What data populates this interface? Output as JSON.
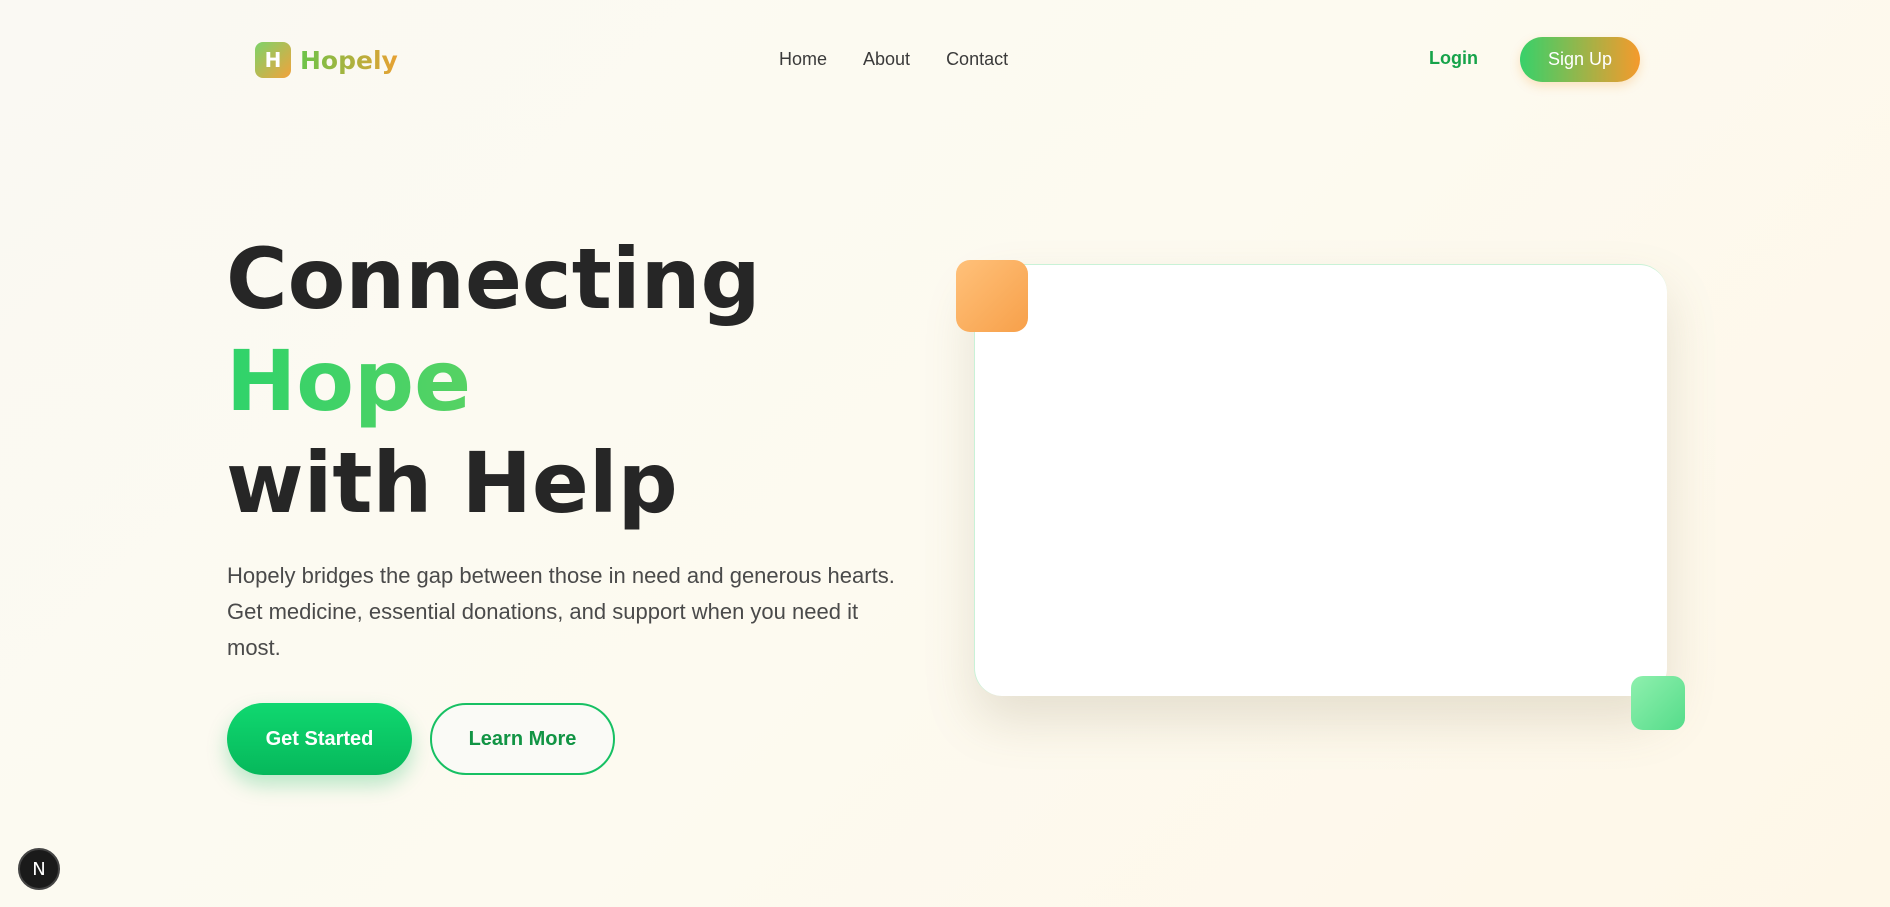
{
  "brand": {
    "logo_letter": "H",
    "name": "Hopely"
  },
  "nav": {
    "links": [
      "Home",
      "About",
      "Contact"
    ],
    "login_label": "Login",
    "signup_label": "Sign Up"
  },
  "hero": {
    "title_line1": "Connecting",
    "title_line2": "Hope",
    "title_line3": "with Help",
    "description": "Hopely bridges the gap between those in need and generous hearts. Get medicine, essential donations, and support when you need it most.",
    "primary_cta": "Get Started",
    "secondary_cta": "Learn More"
  },
  "dev_badge": {
    "letter": "N"
  },
  "colors": {
    "accent_green": "#16a34a",
    "accent_orange": "#f59a2c",
    "heading": "#262626"
  }
}
